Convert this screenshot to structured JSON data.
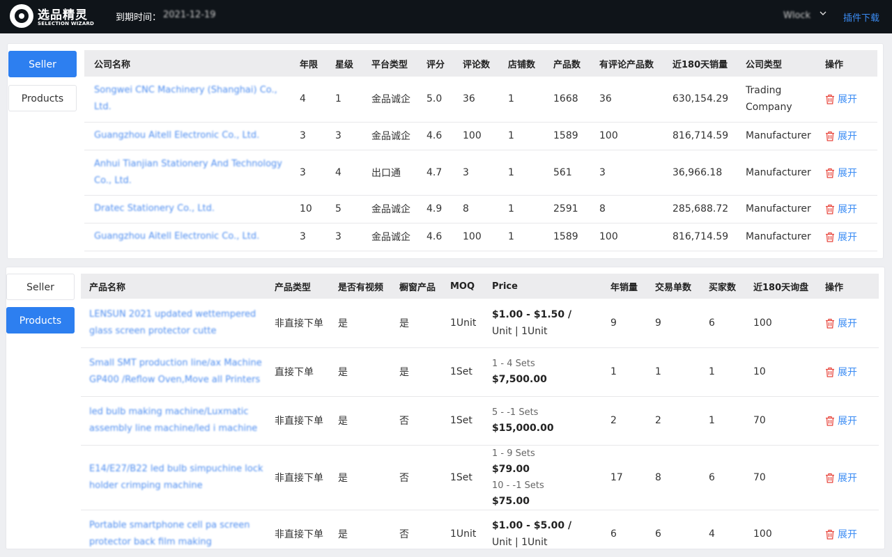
{
  "header": {
    "brand_name": "选品精灵",
    "brand_sub": "SELECTION WIZARD",
    "expiry_label": "到期时间：",
    "expiry_date": "2021-12-19",
    "user_name": "Wlock",
    "plugin_link": "插件下载"
  },
  "seller_section": {
    "tabs": [
      {
        "label": "Seller",
        "active": true
      },
      {
        "label": "Products",
        "active": false
      }
    ],
    "columns": [
      "公司名称",
      "年限",
      "星级",
      "平台类型",
      "评分",
      "评论数",
      "店铺数",
      "产品数",
      "有评论产品数",
      "近180天销量",
      "公司类型",
      "操作"
    ],
    "rows": [
      {
        "name": "Songwei CNC Machinery (Shanghai) Co., Ltd.",
        "years": "4",
        "stars": "1",
        "platform": "金品诚企",
        "score": "5.0",
        "reviews": "36",
        "shops": "1",
        "products": "1668",
        "reviewed_products": "36",
        "sales180": "630,154.29",
        "company_type": "Trading Company",
        "action": "展开"
      },
      {
        "name": "Guangzhou Aitell Electronic Co., Ltd.",
        "years": "3",
        "stars": "3",
        "platform": "金品诚企",
        "score": "4.6",
        "reviews": "100",
        "shops": "1",
        "products": "1589",
        "reviewed_products": "100",
        "sales180": "816,714.59",
        "company_type": "Manufacturer",
        "action": "展开"
      },
      {
        "name": "Anhui Tianjian Stationery And Technology Co., Ltd.",
        "years": "3",
        "stars": "4",
        "platform": "出口通",
        "score": "4.7",
        "reviews": "3",
        "shops": "1",
        "products": "561",
        "reviewed_products": "3",
        "sales180": "36,966.18",
        "company_type": "Manufacturer",
        "action": "展开"
      },
      {
        "name": "Dratec Stationery Co., Ltd.",
        "years": "10",
        "stars": "5",
        "platform": "金品诚企",
        "score": "4.9",
        "reviews": "8",
        "shops": "1",
        "products": "2591",
        "reviewed_products": "8",
        "sales180": "285,688.72",
        "company_type": "Manufacturer",
        "action": "展开"
      },
      {
        "name": "Guangzhou Aitell Electronic Co., Ltd.",
        "years": "3",
        "stars": "3",
        "platform": "金品诚企",
        "score": "4.6",
        "reviews": "100",
        "shops": "1",
        "products": "1589",
        "reviewed_products": "100",
        "sales180": "816,714.59",
        "company_type": "Manufacturer",
        "action": "展开"
      }
    ]
  },
  "products_section": {
    "tabs": [
      {
        "label": "Seller",
        "active": false
      },
      {
        "label": "Products",
        "active": true
      }
    ],
    "columns": [
      "产品名称",
      "产品类型",
      "是否有视频",
      "橱窗产品",
      "MOQ",
      "Price",
      "年销量",
      "交易单数",
      "买家数",
      "近180天询盘",
      "操作"
    ],
    "rows": [
      {
        "name": "LENSUN 2021 updated wettempered glass screen protector cutte",
        "order_type": "非直接下单",
        "video": "是",
        "showcase": "是",
        "moq": "1Unit",
        "price_main": "$1.00 - $1.50 /",
        "price_unit": "Unit  |  1Unit",
        "tiers": [],
        "annual_sales": "9",
        "orders": "9",
        "buyers": "6",
        "inquiries180": "100",
        "action": "展开"
      },
      {
        "name": "Small SMT production line/ax Machine GP400 /Reflow Oven,Move all Printers",
        "order_type": "直接下单",
        "video": "是",
        "showcase": "是",
        "moq": "1Set",
        "price_main": "",
        "price_unit": "",
        "tiers": [
          {
            "range": "1 - 4 Sets",
            "price": "$7,500.00"
          }
        ],
        "annual_sales": "1",
        "orders": "1",
        "buyers": "1",
        "inquiries180": "10",
        "action": "展开"
      },
      {
        "name": "led bulb making machine/Luxmatic assembly line machine/led i machine",
        "order_type": "非直接下单",
        "video": "是",
        "showcase": "否",
        "moq": "1Set",
        "price_main": "",
        "price_unit": "",
        "tiers": [
          {
            "range": "5 - -1 Sets",
            "price": "$15,000.00"
          }
        ],
        "annual_sales": "2",
        "orders": "2",
        "buyers": "1",
        "inquiries180": "70",
        "action": "展开"
      },
      {
        "name": "E14/E27/B22 led bulb simpuchine lock holder crimping machine",
        "order_type": "非直接下单",
        "video": "是",
        "showcase": "否",
        "moq": "1Set",
        "price_main": "",
        "price_unit": "",
        "tiers": [
          {
            "range": "1 - 9 Sets",
            "price": "$79.00"
          },
          {
            "range": "10 - -1 Sets",
            "price": "$75.00"
          }
        ],
        "annual_sales": "17",
        "orders": "8",
        "buyers": "6",
        "inquiries180": "70",
        "action": "展开"
      },
      {
        "name": "Portable smartphone cell pa screen protector back film making",
        "order_type": "非直接下单",
        "video": "是",
        "showcase": "否",
        "moq": "1Unit",
        "price_main": "$1.00 - $5.00 /",
        "price_unit": "Unit  |  1Unit",
        "tiers": [],
        "annual_sales": "6",
        "orders": "6",
        "buyers": "4",
        "inquiries180": "100",
        "action": "展开"
      }
    ]
  },
  "colors": {
    "topbar_bg": "#0f1419",
    "accent_blue": "#2d7ff0",
    "link_blue": "#3b8cf4",
    "delete_red": "#e8473e"
  },
  "icons": {
    "logo": "wizard-logo-icon",
    "dropdown": "chevron-down-icon",
    "delete": "trash-icon"
  }
}
